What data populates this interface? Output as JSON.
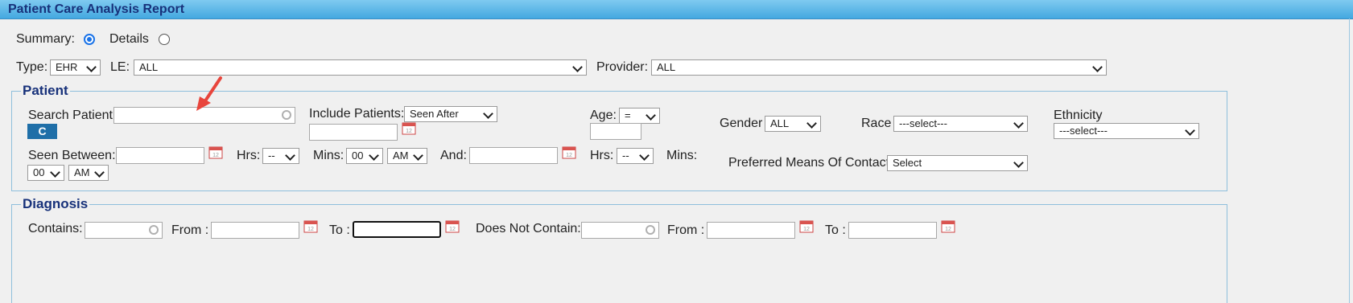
{
  "title": "Patient Care Analysis Report",
  "mode": {
    "summary_label": "Summary:",
    "details_label": "Details",
    "selected": "summary"
  },
  "filters": {
    "type_label": "Type:",
    "type_value": "EHR",
    "le_label": "LE:",
    "le_value": "ALL",
    "provider_label": "Provider:",
    "provider_value": "ALL"
  },
  "patient": {
    "legend": "Patient",
    "search_label": "Search Patient",
    "search_value": "",
    "c_button": "C",
    "include_label": "Include Patients:",
    "include_value": "Seen After",
    "age_label": "Age:",
    "age_op": "=",
    "gender_label": "Gender",
    "gender_value": "ALL",
    "race_label": "Race",
    "race_value": "---select---",
    "ethnicity_label": "Ethnicity",
    "ethnicity_value": "---select---",
    "seen_between_label": "Seen Between:",
    "hrs_label": "Hrs:",
    "hrs_value": "--",
    "mins_label": "Mins:",
    "mins_value": "00",
    "ampm_value": "AM",
    "and_label": "And:",
    "hrs2_label": "Hrs:",
    "hrs2_value": "--",
    "mins2_label": "Mins:",
    "mins2_value": "00",
    "ampm2_value": "AM",
    "contact_label": "Preferred Means Of Contact",
    "contact_value": "Select"
  },
  "diagnosis": {
    "legend": "Diagnosis",
    "contains_label": "Contains:",
    "from_label": "From :",
    "to_label": "To :",
    "not_contain_label": "Does Not Contain:",
    "from2_label": "From :",
    "to2_label": "To :"
  },
  "colors": {
    "title_bar": "#43a8e0",
    "legend_text": "#17317a",
    "accent": "#1a73e8",
    "annotation_arrow": "#e8453c"
  },
  "icons": {
    "calendar": "calendar-icon",
    "search": "search-icon",
    "arrow": "annotation-arrow-icon"
  }
}
